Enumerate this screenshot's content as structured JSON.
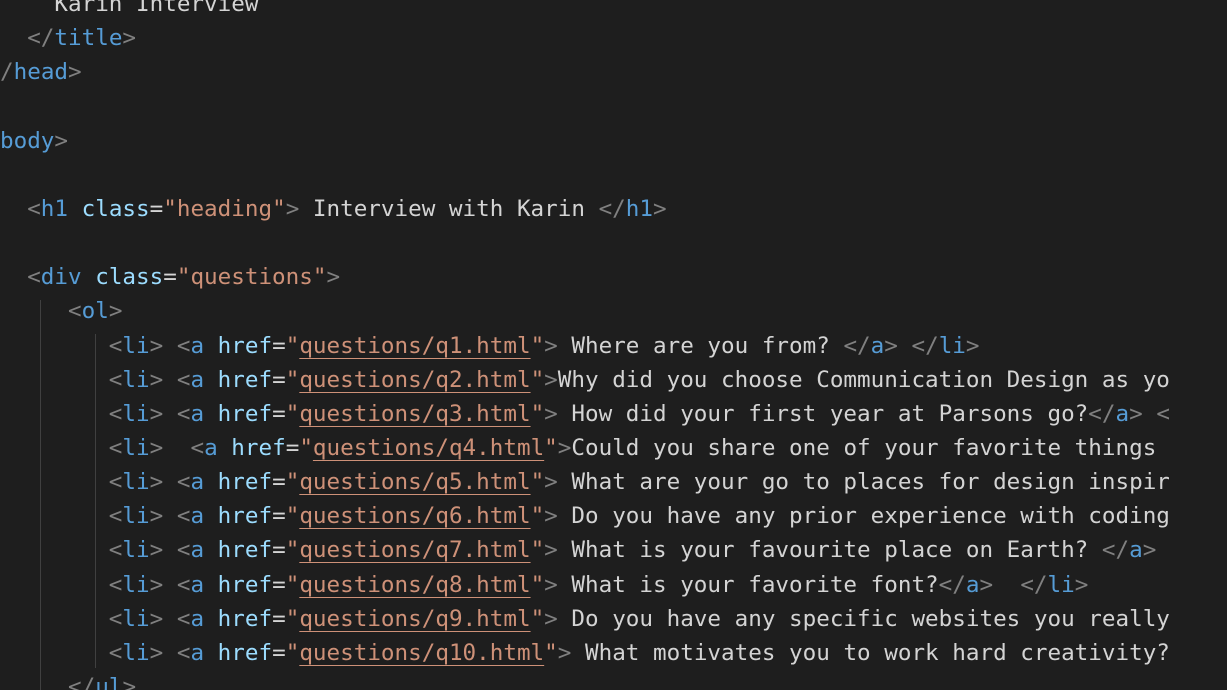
{
  "editor": {
    "lines": [
      {
        "indent": "    ",
        "tokens": [
          {
            "t": "tx",
            "v": "Karin Interview"
          }
        ]
      },
      {
        "indent": "  ",
        "tokens": [
          {
            "t": "pu",
            "v": "</"
          },
          {
            "t": "tg",
            "v": "title"
          },
          {
            "t": "pu",
            "v": ">"
          }
        ]
      },
      {
        "indent": "",
        "tokens": [
          {
            "t": "pu",
            "v": "/"
          },
          {
            "t": "tg",
            "v": "head"
          },
          {
            "t": "pu",
            "v": ">"
          }
        ]
      },
      {
        "indent": "",
        "tokens": []
      },
      {
        "indent": "",
        "tokens": [
          {
            "t": "tg",
            "v": "body"
          },
          {
            "t": "pu",
            "v": ">"
          }
        ]
      },
      {
        "indent": "",
        "tokens": []
      },
      {
        "indent": "  ",
        "tokens": [
          {
            "t": "pu",
            "v": "<"
          },
          {
            "t": "tg",
            "v": "h1"
          },
          {
            "t": "tx",
            "v": " "
          },
          {
            "t": "at",
            "v": "class"
          },
          {
            "t": "tx",
            "v": "="
          },
          {
            "t": "st",
            "v": "\"heading\""
          },
          {
            "t": "pu",
            "v": ">"
          },
          {
            "t": "tx",
            "v": " Interview with Karin "
          },
          {
            "t": "pu",
            "v": "</"
          },
          {
            "t": "tg",
            "v": "h1"
          },
          {
            "t": "pu",
            "v": ">"
          }
        ]
      },
      {
        "indent": "",
        "tokens": []
      },
      {
        "indent": "  ",
        "tokens": [
          {
            "t": "pu",
            "v": "<"
          },
          {
            "t": "tg",
            "v": "div"
          },
          {
            "t": "tx",
            "v": " "
          },
          {
            "t": "at",
            "v": "class"
          },
          {
            "t": "tx",
            "v": "="
          },
          {
            "t": "st",
            "v": "\"questions\""
          },
          {
            "t": "pu",
            "v": ">"
          }
        ]
      },
      {
        "indent": "     ",
        "tokens": [
          {
            "t": "pu",
            "v": "<"
          },
          {
            "t": "tg",
            "v": "ol"
          },
          {
            "t": "pu",
            "v": ">"
          }
        ]
      },
      {
        "indent": "        ",
        "tokens": [
          {
            "t": "pu",
            "v": "<"
          },
          {
            "t": "tg",
            "v": "li"
          },
          {
            "t": "pu",
            "v": ">"
          },
          {
            "t": "tx",
            "v": " "
          },
          {
            "t": "pu",
            "v": "<"
          },
          {
            "t": "tg",
            "v": "a"
          },
          {
            "t": "tx",
            "v": " "
          },
          {
            "t": "at",
            "v": "href"
          },
          {
            "t": "tx",
            "v": "="
          },
          {
            "t": "st",
            "v": "\""
          },
          {
            "t": "lk",
            "v": "questions/q1.html"
          },
          {
            "t": "st",
            "v": "\""
          },
          {
            "t": "pu",
            "v": ">"
          },
          {
            "t": "tx",
            "v": " Where are you from? "
          },
          {
            "t": "pu",
            "v": "</"
          },
          {
            "t": "tg",
            "v": "a"
          },
          {
            "t": "pu",
            "v": ">"
          },
          {
            "t": "tx",
            "v": " "
          },
          {
            "t": "pu",
            "v": "</"
          },
          {
            "t": "tg",
            "v": "li"
          },
          {
            "t": "pu",
            "v": ">"
          }
        ]
      },
      {
        "indent": "        ",
        "tokens": [
          {
            "t": "pu",
            "v": "<"
          },
          {
            "t": "tg",
            "v": "li"
          },
          {
            "t": "pu",
            "v": ">"
          },
          {
            "t": "tx",
            "v": " "
          },
          {
            "t": "pu",
            "v": "<"
          },
          {
            "t": "tg",
            "v": "a"
          },
          {
            "t": "tx",
            "v": " "
          },
          {
            "t": "at",
            "v": "href"
          },
          {
            "t": "tx",
            "v": "="
          },
          {
            "t": "st",
            "v": "\""
          },
          {
            "t": "lk",
            "v": "questions/q2.html"
          },
          {
            "t": "st",
            "v": "\""
          },
          {
            "t": "pu",
            "v": ">"
          },
          {
            "t": "tx",
            "v": "Why did you choose Communication Design as yo"
          }
        ]
      },
      {
        "indent": "        ",
        "tokens": [
          {
            "t": "pu",
            "v": "<"
          },
          {
            "t": "tg",
            "v": "li"
          },
          {
            "t": "pu",
            "v": ">"
          },
          {
            "t": "tx",
            "v": " "
          },
          {
            "t": "pu",
            "v": "<"
          },
          {
            "t": "tg",
            "v": "a"
          },
          {
            "t": "tx",
            "v": " "
          },
          {
            "t": "at",
            "v": "href"
          },
          {
            "t": "tx",
            "v": "="
          },
          {
            "t": "st",
            "v": "\""
          },
          {
            "t": "lk",
            "v": "questions/q3.html"
          },
          {
            "t": "st",
            "v": "\""
          },
          {
            "t": "pu",
            "v": ">"
          },
          {
            "t": "tx",
            "v": " How did your first year at Parsons go?"
          },
          {
            "t": "pu",
            "v": "</"
          },
          {
            "t": "tg",
            "v": "a"
          },
          {
            "t": "pu",
            "v": ">"
          },
          {
            "t": "tx",
            "v": " "
          },
          {
            "t": "pu",
            "v": "<"
          }
        ]
      },
      {
        "indent": "        ",
        "tokens": [
          {
            "t": "pu",
            "v": "<"
          },
          {
            "t": "tg",
            "v": "li"
          },
          {
            "t": "pu",
            "v": ">"
          },
          {
            "t": "tx",
            "v": "  "
          },
          {
            "t": "pu",
            "v": "<"
          },
          {
            "t": "tg",
            "v": "a"
          },
          {
            "t": "tx",
            "v": " "
          },
          {
            "t": "at",
            "v": "href"
          },
          {
            "t": "tx",
            "v": "="
          },
          {
            "t": "st",
            "v": "\""
          },
          {
            "t": "lk",
            "v": "questions/q4.html"
          },
          {
            "t": "st",
            "v": "\""
          },
          {
            "t": "pu",
            "v": ">"
          },
          {
            "t": "tx",
            "v": "Could you share one of your favorite things"
          }
        ]
      },
      {
        "indent": "        ",
        "tokens": [
          {
            "t": "pu",
            "v": "<"
          },
          {
            "t": "tg",
            "v": "li"
          },
          {
            "t": "pu",
            "v": ">"
          },
          {
            "t": "tx",
            "v": " "
          },
          {
            "t": "pu",
            "v": "<"
          },
          {
            "t": "tg",
            "v": "a"
          },
          {
            "t": "tx",
            "v": " "
          },
          {
            "t": "at",
            "v": "href"
          },
          {
            "t": "tx",
            "v": "="
          },
          {
            "t": "st",
            "v": "\""
          },
          {
            "t": "lk",
            "v": "questions/q5.html"
          },
          {
            "t": "st",
            "v": "\""
          },
          {
            "t": "pu",
            "v": ">"
          },
          {
            "t": "tx",
            "v": " What are your go to places for design inspir"
          }
        ]
      },
      {
        "indent": "        ",
        "tokens": [
          {
            "t": "pu",
            "v": "<"
          },
          {
            "t": "tg",
            "v": "li"
          },
          {
            "t": "pu",
            "v": ">"
          },
          {
            "t": "tx",
            "v": " "
          },
          {
            "t": "pu",
            "v": "<"
          },
          {
            "t": "tg",
            "v": "a"
          },
          {
            "t": "tx",
            "v": " "
          },
          {
            "t": "at",
            "v": "href"
          },
          {
            "t": "tx",
            "v": "="
          },
          {
            "t": "st",
            "v": "\""
          },
          {
            "t": "lk",
            "v": "questions/q6.html"
          },
          {
            "t": "st",
            "v": "\""
          },
          {
            "t": "pu",
            "v": ">"
          },
          {
            "t": "tx",
            "v": " Do you have any prior experience with coding"
          }
        ]
      },
      {
        "indent": "        ",
        "tokens": [
          {
            "t": "pu",
            "v": "<"
          },
          {
            "t": "tg",
            "v": "li"
          },
          {
            "t": "pu",
            "v": ">"
          },
          {
            "t": "tx",
            "v": " "
          },
          {
            "t": "pu",
            "v": "<"
          },
          {
            "t": "tg",
            "v": "a"
          },
          {
            "t": "tx",
            "v": " "
          },
          {
            "t": "at",
            "v": "href"
          },
          {
            "t": "tx",
            "v": "="
          },
          {
            "t": "st",
            "v": "\""
          },
          {
            "t": "lk",
            "v": "questions/q7.html"
          },
          {
            "t": "st",
            "v": "\""
          },
          {
            "t": "pu",
            "v": ">"
          },
          {
            "t": "tx",
            "v": " What is your favourite place on Earth? "
          },
          {
            "t": "pu",
            "v": "</"
          },
          {
            "t": "tg",
            "v": "a"
          },
          {
            "t": "pu",
            "v": ">"
          }
        ]
      },
      {
        "indent": "        ",
        "tokens": [
          {
            "t": "pu",
            "v": "<"
          },
          {
            "t": "tg",
            "v": "li"
          },
          {
            "t": "pu",
            "v": ">"
          },
          {
            "t": "tx",
            "v": " "
          },
          {
            "t": "pu",
            "v": "<"
          },
          {
            "t": "tg",
            "v": "a"
          },
          {
            "t": "tx",
            "v": " "
          },
          {
            "t": "at",
            "v": "href"
          },
          {
            "t": "tx",
            "v": "="
          },
          {
            "t": "st",
            "v": "\""
          },
          {
            "t": "lk",
            "v": "questions/q8.html"
          },
          {
            "t": "st",
            "v": "\""
          },
          {
            "t": "pu",
            "v": ">"
          },
          {
            "t": "tx",
            "v": " What is your favorite font?"
          },
          {
            "t": "pu",
            "v": "</"
          },
          {
            "t": "tg",
            "v": "a"
          },
          {
            "t": "pu",
            "v": ">"
          },
          {
            "t": "tx",
            "v": "  "
          },
          {
            "t": "pu",
            "v": "</"
          },
          {
            "t": "tg",
            "v": "li"
          },
          {
            "t": "pu",
            "v": ">"
          }
        ]
      },
      {
        "indent": "        ",
        "tokens": [
          {
            "t": "pu",
            "v": "<"
          },
          {
            "t": "tg",
            "v": "li"
          },
          {
            "t": "pu",
            "v": ">"
          },
          {
            "t": "tx",
            "v": " "
          },
          {
            "t": "pu",
            "v": "<"
          },
          {
            "t": "tg",
            "v": "a"
          },
          {
            "t": "tx",
            "v": " "
          },
          {
            "t": "at",
            "v": "href"
          },
          {
            "t": "tx",
            "v": "="
          },
          {
            "t": "st",
            "v": "\""
          },
          {
            "t": "lk",
            "v": "questions/q9.html"
          },
          {
            "t": "st",
            "v": "\""
          },
          {
            "t": "pu",
            "v": ">"
          },
          {
            "t": "tx",
            "v": " Do you have any specific websites you really"
          }
        ]
      },
      {
        "indent": "        ",
        "tokens": [
          {
            "t": "pu",
            "v": "<"
          },
          {
            "t": "tg",
            "v": "li"
          },
          {
            "t": "pu",
            "v": ">"
          },
          {
            "t": "tx",
            "v": " "
          },
          {
            "t": "pu",
            "v": "<"
          },
          {
            "t": "tg",
            "v": "a"
          },
          {
            "t": "tx",
            "v": " "
          },
          {
            "t": "at",
            "v": "href"
          },
          {
            "t": "tx",
            "v": "="
          },
          {
            "t": "st",
            "v": "\""
          },
          {
            "t": "lk",
            "v": "questions/q10.html"
          },
          {
            "t": "st",
            "v": "\""
          },
          {
            "t": "pu",
            "v": ">"
          },
          {
            "t": "tx",
            "v": " What motivates you to work hard creativity?"
          }
        ]
      },
      {
        "indent": "     ",
        "tokens": [
          {
            "t": "pu",
            "v": "</"
          },
          {
            "t": "tg",
            "v": "ul"
          },
          {
            "t": "pu",
            "v": ">"
          }
        ]
      }
    ]
  },
  "colors": {
    "background": "#1e1e1e",
    "tag": "#569cd6",
    "attribute": "#9cdcfe",
    "string": "#ce9178",
    "punctuation": "#808080",
    "text": "#d4d4d4",
    "indent_guide": "#404040"
  }
}
